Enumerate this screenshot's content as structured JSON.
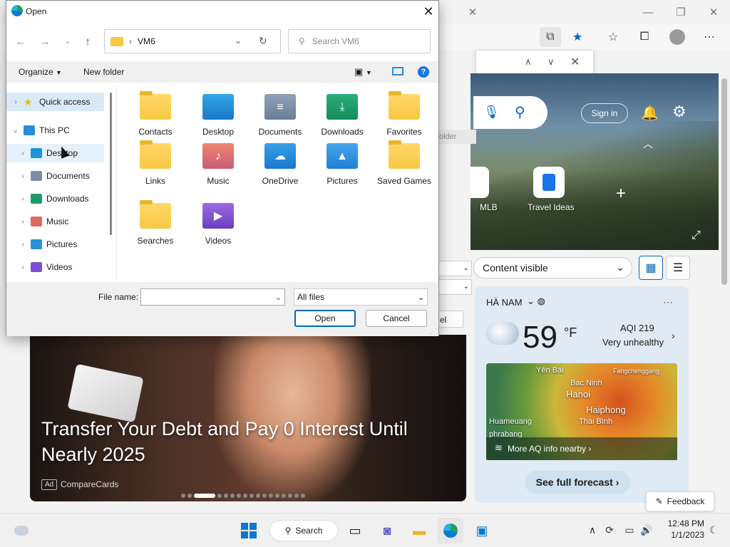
{
  "dialog": {
    "title": "Open",
    "close_icon": "✕",
    "address": {
      "folder": "VM6",
      "separator": "›"
    },
    "search_placeholder": "Search VM6",
    "organize_label": "Organize",
    "new_folder_label": "New folder",
    "help_icon": "?",
    "tree": [
      {
        "label": "Quick access",
        "icon": "star-icon",
        "color": "#f2b600",
        "selected": true,
        "expanded": false
      },
      {
        "label": "This PC",
        "icon": "computer-icon",
        "color": "#2a8bd6",
        "expanded": true
      },
      {
        "label": "Desktop",
        "icon": "desktop-folder-icon",
        "color": "#1e95d6",
        "hover": true
      },
      {
        "label": "Documents",
        "icon": "documents-folder-icon",
        "color": "#7b8ea3"
      },
      {
        "label": "Downloads",
        "icon": "downloads-folder-icon",
        "color": "#1f9b6a"
      },
      {
        "label": "Music",
        "icon": "music-folder-icon",
        "color": "#e06a5a"
      },
      {
        "label": "Pictures",
        "icon": "pictures-folder-icon",
        "color": "#2a90d8"
      },
      {
        "label": "Videos",
        "icon": "videos-folder-icon",
        "color": "#7b4fd1"
      }
    ],
    "files": [
      {
        "label": "Contacts",
        "icon": "contacts-folder-icon",
        "kind": "yellow"
      },
      {
        "label": "Desktop",
        "icon": "desktop-folder-icon",
        "kind": "desktop"
      },
      {
        "label": "Documents",
        "icon": "documents-folder-icon",
        "kind": "documents"
      },
      {
        "label": "Downloads",
        "icon": "downloads-folder-icon",
        "kind": "downloads"
      },
      {
        "label": "Favorites",
        "icon": "favorites-folder-icon",
        "kind": "yellow"
      },
      {
        "label": "Links",
        "icon": "links-folder-icon",
        "kind": "yellow"
      },
      {
        "label": "Music",
        "icon": "music-folder-icon",
        "kind": "music"
      },
      {
        "label": "OneDrive",
        "icon": "onedrive-folder-icon",
        "kind": "onedrive"
      },
      {
        "label": "Pictures",
        "icon": "pictures-folder-icon",
        "kind": "pictures"
      },
      {
        "label": "Saved Games",
        "icon": "saved-games-folder-icon",
        "kind": "yellow"
      },
      {
        "label": "Searches",
        "icon": "searches-folder-icon",
        "kind": "yellow"
      },
      {
        "label": "Videos",
        "icon": "videos-folder-icon",
        "kind": "videos"
      }
    ],
    "file_name_label": "File name:",
    "file_name_value": "",
    "filter_value": "All files",
    "open_label": "Open",
    "cancel_label": "Cancel"
  },
  "browser": {
    "signin_label": "Sign in",
    "tiles": [
      {
        "label": "MLB"
      },
      {
        "label": "Travel Ideas"
      }
    ],
    "content_visible_label": "Content visible",
    "partial_folder_text": "older",
    "partial_cancel_text": "el",
    "weather": {
      "location": "HÀ NAM",
      "temperature": "59",
      "unit": "°F",
      "aqi": "AQI 219",
      "aqi_status": "Very unhealthy",
      "map_places": [
        "Yên Bái",
        "Bac Ninh",
        "Hanoi",
        "Fangchenggang",
        "Haiphong",
        "Huameuang",
        "Thái Bình",
        "phrabang"
      ],
      "more_aq_label": "More AQ info nearby ›",
      "forecast_label": "See full forecast ›"
    },
    "promo": {
      "title": "Transfer Your Debt and Pay 0 Interest Until Nearly 2025",
      "ad_badge": "Ad",
      "source": "CompareCards",
      "dot_count": 17,
      "active_dot": 2
    },
    "feedback_label": "Feedback"
  },
  "taskbar": {
    "search_label": "Search",
    "time": "12:48 PM",
    "date": "1/1/2023"
  },
  "colors": {
    "accent": "#0067c0",
    "selection": "#d9eaf7"
  }
}
